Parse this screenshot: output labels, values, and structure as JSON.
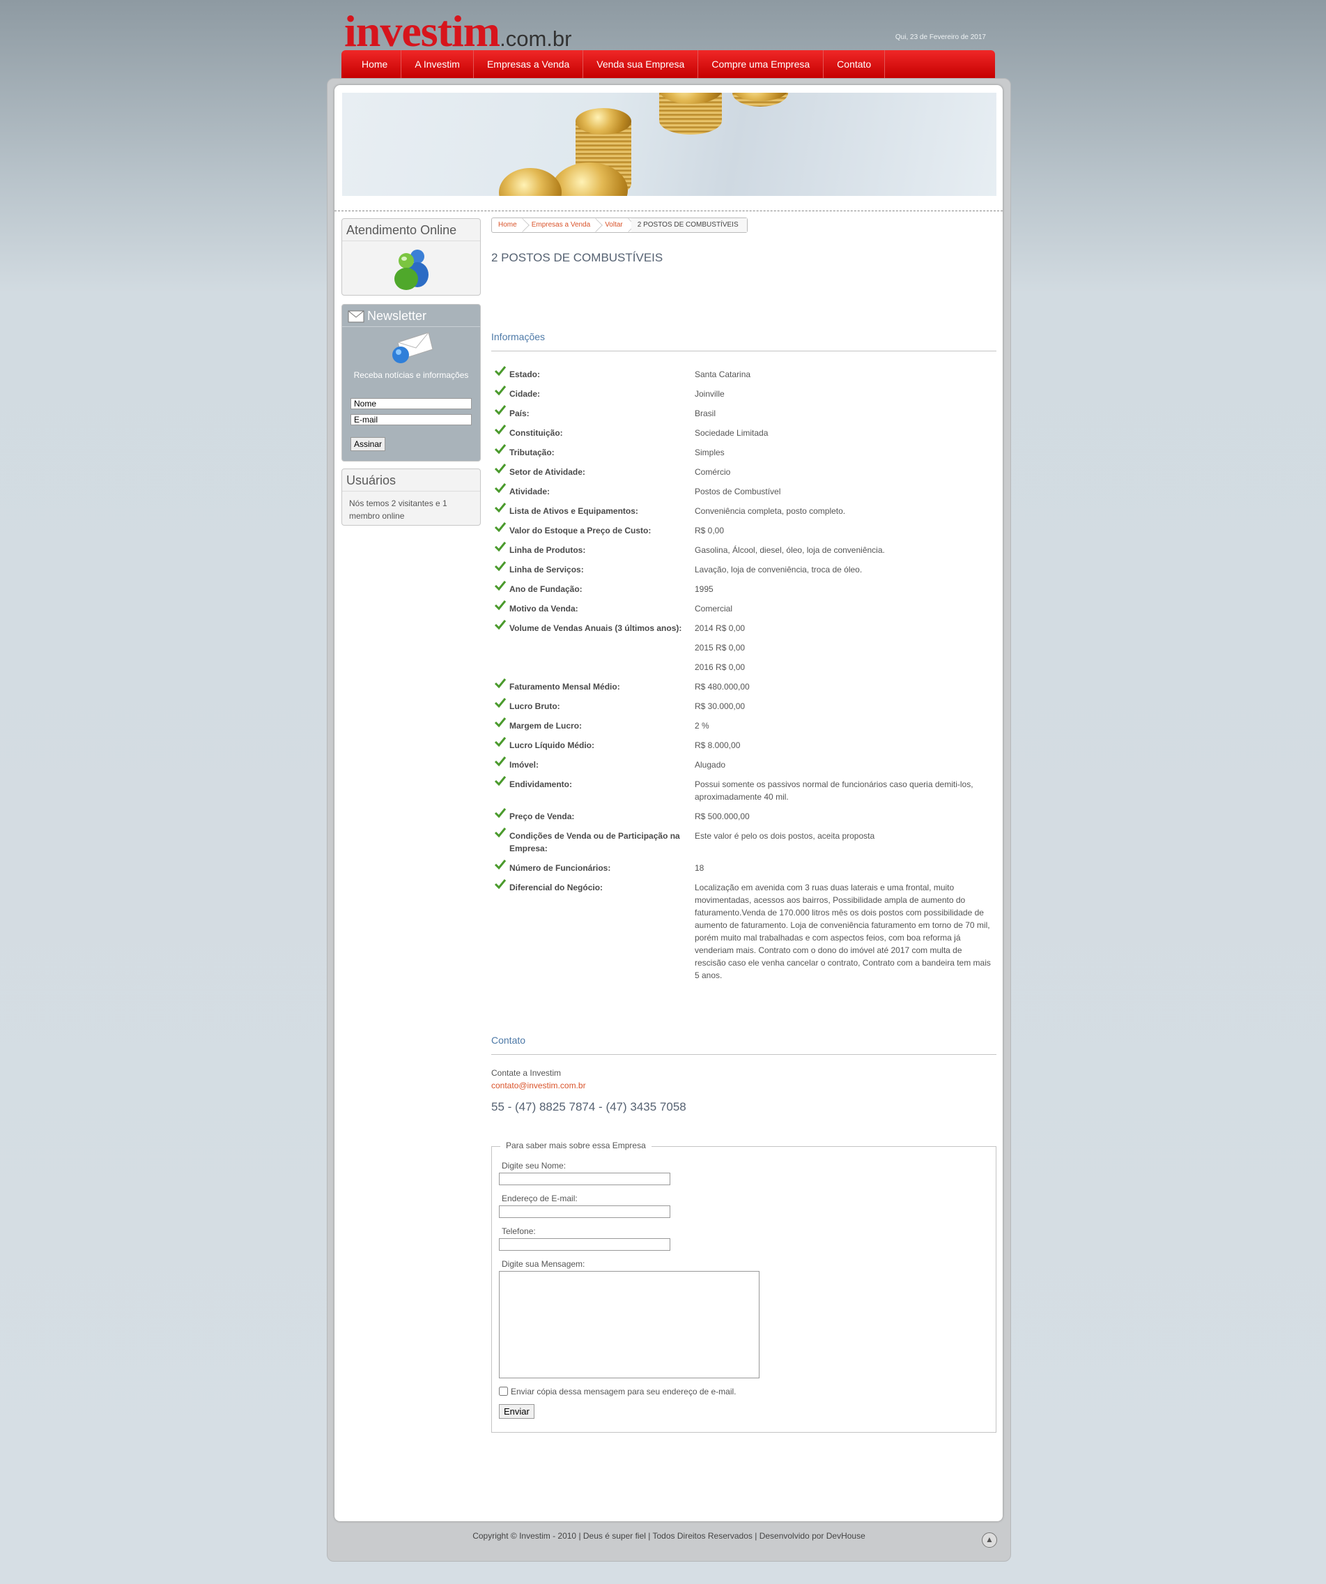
{
  "header": {
    "logo_main": "investim",
    "logo_suffix": ".com.br",
    "date": "Qui, 23 de Fevereiro de 2017"
  },
  "nav": [
    "Home",
    "A Investim",
    "Empresas a Venda",
    "Venda sua Empresa",
    "Compre uma Empresa",
    "Contato"
  ],
  "sidebar": {
    "atendimento_title": "Atendimento Online",
    "newsletter_title": "Newsletter",
    "newsletter_text": "Receba notícias e informações",
    "name_value": "Nome",
    "email_value": "E-mail",
    "subscribe_label": "Assinar",
    "users_title": "Usuários",
    "users_text": "Nós temos 2 visitantes e 1 membro online"
  },
  "breadcrumb": [
    "Home",
    "Empresas a Venda",
    "Voltar",
    "2 POSTOS DE COMBUSTÍVEIS"
  ],
  "page_title": "2 POSTOS DE COMBUSTÍVEIS",
  "info_title": "Informações",
  "info_rows": [
    {
      "label": "Estado:",
      "value": "Santa Catarina"
    },
    {
      "label": "Cidade:",
      "value": "Joinville"
    },
    {
      "label": "País:",
      "value": "Brasil"
    },
    {
      "label": "Constituição:",
      "value": "Sociedade Limitada"
    },
    {
      "label": "Tributação:",
      "value": "Simples"
    },
    {
      "label": "Setor de Atividade:",
      "value": "Comércio"
    },
    {
      "label": "Atividade:",
      "value": "Postos de Combustível"
    },
    {
      "label": "Lista de Ativos e Equipamentos:",
      "value": "Conveniência completa, posto completo."
    },
    {
      "label": "Valor do Estoque a Preço de Custo:",
      "value": "R$ 0,00"
    },
    {
      "label": "Linha de Produtos:",
      "value": "Gasolina, Álcool, diesel, óleo, loja de conveniência."
    },
    {
      "label": "Linha de Serviços:",
      "value": "Lavação, loja de conveniência, troca de óleo."
    },
    {
      "label": "Ano de Fundação:",
      "value": "1995"
    },
    {
      "label": "Motivo da Venda:",
      "value": "Comercial"
    },
    {
      "label": "Volume de Vendas Anuais (3 últimos anos):",
      "value": "2014 R$ 0,00"
    },
    {
      "label": "",
      "value": "2015 R$ 0,00"
    },
    {
      "label": "",
      "value": "2016 R$ 0,00"
    },
    {
      "label": "Faturamento Mensal Médio:",
      "value": "R$ 480.000,00"
    },
    {
      "label": "Lucro Bruto:",
      "value": "R$ 30.000,00"
    },
    {
      "label": "Margem de Lucro:",
      "value": "2 %"
    },
    {
      "label": "Lucro Líquido Médio:",
      "value": "R$ 8.000,00"
    },
    {
      "label": "Imóvel:",
      "value": "Alugado"
    },
    {
      "label": "Endividamento:",
      "value": "Possui somente os passivos normal de funcionários caso queria demiti-los, aproximadamente 40 mil."
    },
    {
      "label": "Preço de Venda:",
      "value": "R$ 500.000,00"
    },
    {
      "label": "Condições de Venda ou de Participação na Empresa:",
      "value": "Este valor é pelo os dois postos, aceita proposta"
    },
    {
      "label": "Número de Funcionários:",
      "value": "18"
    },
    {
      "label": "Diferencial do Negócio:",
      "value": "Localização em avenida com 3 ruas duas laterais e uma frontal, muito movimentadas, acessos aos bairros, Possibilidade ampla de aumento do faturamento.Venda de 170.000 litros mês os dois postos com possibilidade de aumento de faturamento. Loja de conveniência faturamento em torno de 70 mil, porém muito mal trabalhadas e com aspectos feios, com boa reforma já venderiam mais. Contrato com o dono do imóvel até 2017 com multa de rescisão caso ele venha cancelar o contrato, Contrato com a bandeira tem mais 5 anos."
    }
  ],
  "contact": {
    "title": "Contato",
    "line1": "Contate a Investim",
    "email": "contato@investim.com.br",
    "phone": "55 - (47) 8825 7874 - (47) 3435 7058"
  },
  "form": {
    "legend": "Para saber mais sobre essa Empresa",
    "name_label": "Digite seu Nome:",
    "email_label": "Endereço de E-mail:",
    "phone_label": "Telefone:",
    "message_label": "Digite sua Mensagem:",
    "copy_label": "Enviar cópia dessa mensagem para seu endereço de e-mail.",
    "submit_label": "Enviar"
  },
  "footer": {
    "text": "Copyright © Investim - 2010 | Deus é super fiel | Todos Direitos Reservados | Desenvolvido por DevHouse"
  },
  "icons": [
    "messenger-users-icon",
    "envelope-icon",
    "envelope-globe-icon",
    "check-icon",
    "arrow-up-icon"
  ],
  "colors": {
    "brand_red": "#d7141c",
    "link_orange": "#d9532a",
    "section_blue": "#4d79a7"
  }
}
